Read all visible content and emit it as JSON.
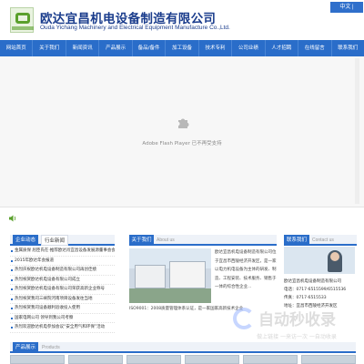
{
  "header": {
    "company_cn": "欧达宜昌机电设备制造有限公司",
    "company_en": "Ouda Yichang Machinery and Electrical Equipment Manufacture Co.,Ltd.",
    "lang_switch": "中文 | English"
  },
  "nav": {
    "items": [
      {
        "label": "网站首页"
      },
      {
        "label": "关于我们"
      },
      {
        "label": "新闻资讯"
      },
      {
        "label": "产品展示"
      },
      {
        "label": "备品/备件"
      },
      {
        "label": "加工设备"
      },
      {
        "label": "技术专利"
      },
      {
        "label": "公司业绩"
      },
      {
        "label": "人才招聘"
      },
      {
        "label": "在线留言"
      },
      {
        "label": "联系我们"
      }
    ],
    "color": "#2a6dc9"
  },
  "banner": {
    "flash_text": "Adobe Flash Player 已不再受支持"
  },
  "news": {
    "tab_active": "企业动态",
    "tab_other": "行业新闻",
    "items": [
      "金属质保 屈臣氏在·推荐欧达肖宜昌设备发展源董事会会",
      "2015年欧达年会报道",
      "热烈庆祝欧达机电设备制造有限公司再创佳绩",
      "热烈祝贺欧达机电设备有限公司成立",
      "热烈祝贺欧达机电设备有限公司荣获高新企业称号",
      "热烈祝贺我司三峡院河南项目设备发往当地",
      "热烈祝贺我司设备顺利验收投入使用",
      "国家电网公司 领导到我公司考察",
      "热烈欢迎欧达机电参加会议“安全用气和环保”活动"
    ]
  },
  "about": {
    "tab": "关于我们",
    "sub": "About us",
    "text": "欧达宜昌机电设备制造有限公司位于宜昌市西陵经济开发区，是一家以电力机电设备为主体的研发、制造、工程安装、技术服务、销售于一体的综合性企业...",
    "bottom": "ISO9001：2008质量管理体系认证，是一家国家高新技术企业"
  },
  "contact": {
    "tab": "联系我们",
    "sub": "Contact us",
    "lines": [
      "欧达宜昌机电设备制造有限公司",
      "电话：0717-6515599/6515536",
      "传真：0717-6515533",
      "地址：宜昌市西陵经济开发区"
    ]
  },
  "products": {
    "tab": "产品展示",
    "sub": "Products"
  },
  "watermark": {
    "title": "自动秒收录",
    "sub": "做上链接 一来访一次 一自动收录"
  }
}
